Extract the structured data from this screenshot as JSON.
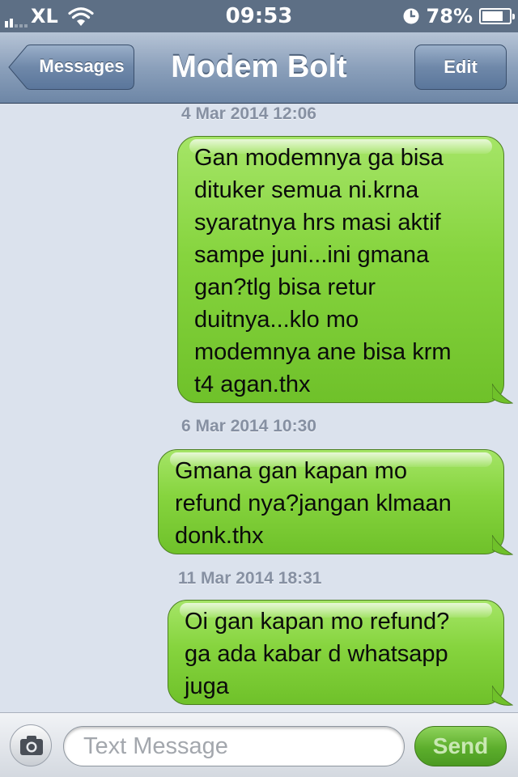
{
  "status_bar": {
    "carrier": "XL",
    "time": "09:53",
    "battery_percent": "78%",
    "battery_level": 0.78,
    "icons": [
      "signal-bars-icon",
      "wifi-icon",
      "alarm-clock-icon",
      "battery-icon"
    ]
  },
  "nav": {
    "back_label": "Messages",
    "title": "Modem Bolt",
    "edit_label": "Edit"
  },
  "conversation": [
    {
      "timestamp": "4 Mar 2014 12:06",
      "sender": "me",
      "text": "Gan modemnya ga bisa\ndituker semua ni.krna\nsyaratnya hrs masi aktif\nsampe juni...ini gmana\ngan?tlg bisa retur\nduitnya...klo mo\nmodemnya ane bisa krm\nt4 agan.thx"
    },
    {
      "timestamp": "6 Mar 2014 10:30",
      "sender": "me",
      "text": "Gmana gan kapan mo\nrefund nya?jangan klmaan\ndonk.thx"
    },
    {
      "timestamp": "11 Mar 2014 18:31",
      "sender": "me",
      "text": "Oi gan kapan mo refund?\nga ada kabar d whatsapp\njuga"
    }
  ],
  "composer": {
    "placeholder": "Text Message",
    "value": "",
    "send_label": "Send",
    "camera_icon": "camera-icon"
  },
  "colors": {
    "bubble_green": "#86d43e",
    "nav_blue": "#8ba0bb",
    "background": "#dbe2ed"
  }
}
